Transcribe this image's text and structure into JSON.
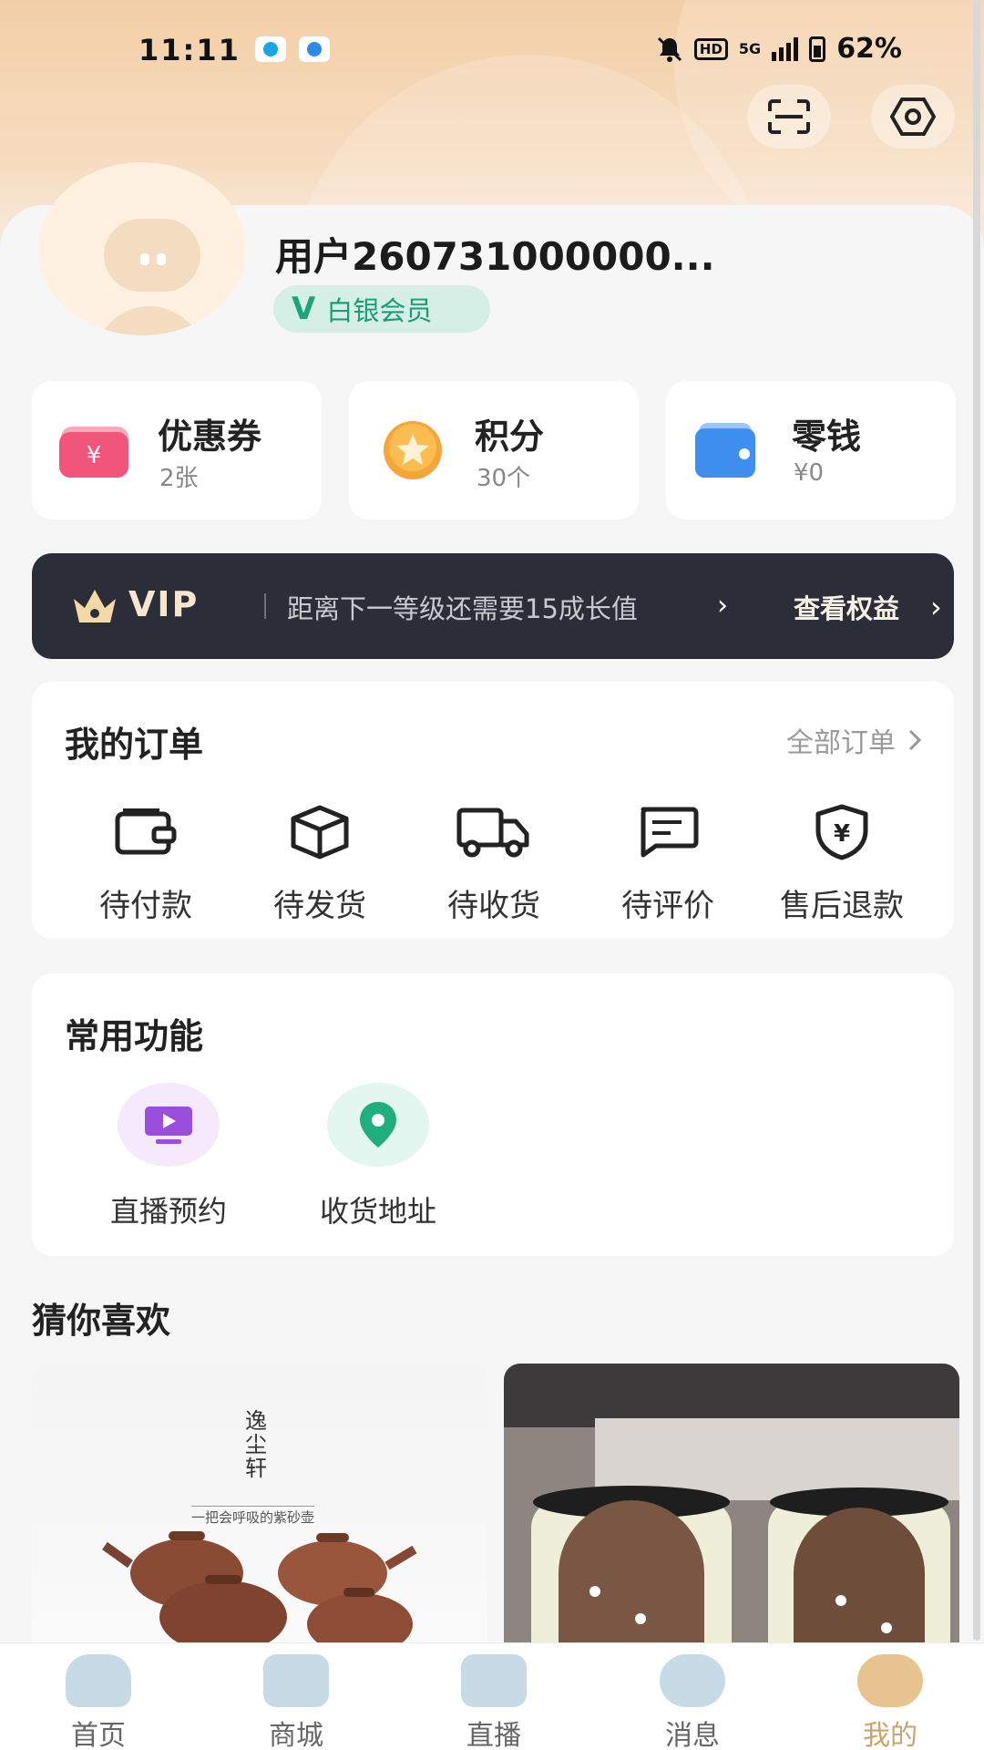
{
  "status_bar": {
    "time": "11:11",
    "network": "5G",
    "hd": "HD",
    "battery": "62%"
  },
  "header": {
    "scan_icon": "scan-icon",
    "settings_icon": "settings-icon"
  },
  "profile": {
    "username": "用户260731000000...",
    "member_badge_letter": "V",
    "member_level": "白银会员"
  },
  "assets": [
    {
      "label": "优惠券",
      "value": "2张",
      "icon": "coupon-icon",
      "color": "#f2557a"
    },
    {
      "label": "积分",
      "value": "30个",
      "icon": "points-star-icon",
      "color": "#f6a53a"
    },
    {
      "label": "零钱",
      "value": "¥0",
      "icon": "wallet-icon",
      "color": "#3f8ff0"
    }
  ],
  "vip": {
    "title": "VIP",
    "tip": "距离下一等级还需要15成长值",
    "tip_chevron": "›",
    "view_label": "查看权益",
    "view_chevron": "›"
  },
  "orders": {
    "title": "我的订单",
    "all_label": "全部订单",
    "items": [
      {
        "label": "待付款",
        "icon": "wallet-pay-icon"
      },
      {
        "label": "待发货",
        "icon": "package-box-icon"
      },
      {
        "label": "待收货",
        "icon": "delivery-truck-icon"
      },
      {
        "label": "待评价",
        "icon": "comment-icon"
      },
      {
        "label": "售后退款",
        "icon": "refund-shield-icon"
      }
    ]
  },
  "functions": {
    "title": "常用功能",
    "items": [
      {
        "label": "直播预约",
        "icon": "live-reserve-icon",
        "color": "#9b4ddc"
      },
      {
        "label": "收货地址",
        "icon": "location-pin-icon",
        "color": "#1fae7e"
      }
    ]
  },
  "recommend": {
    "title": "猜你喜欢",
    "products": [
      {
        "brand": "逸尘轩",
        "slogan": "一把会呼吸的紫砂壶"
      },
      {
        "brand": ""
      }
    ]
  },
  "tabbar": [
    {
      "label": "首页",
      "active": false
    },
    {
      "label": "商城",
      "active": false
    },
    {
      "label": "直播",
      "active": false
    },
    {
      "label": "消息",
      "active": false
    },
    {
      "label": "我的",
      "active": true
    }
  ],
  "colors": {
    "accent": "#c9a56c",
    "vip_bg": "#2b2e39",
    "member_green": "#1e9b75"
  }
}
